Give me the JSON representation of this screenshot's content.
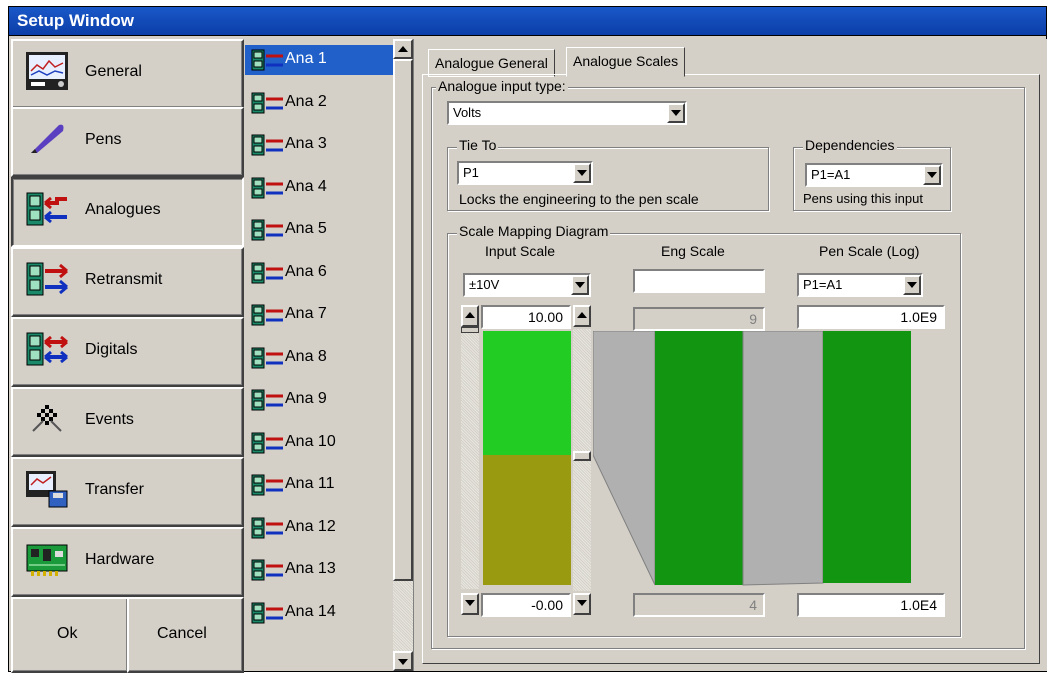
{
  "window": {
    "title": "Setup Window"
  },
  "nav": {
    "buttons": [
      {
        "label": "General",
        "icon": "recorder-icon"
      },
      {
        "label": "Pens",
        "icon": "quill-pen-icon"
      },
      {
        "label": "Analogues",
        "icon": "analogue-arrows-icon"
      },
      {
        "label": "Retransmit",
        "icon": "retransmit-arrows-icon"
      },
      {
        "label": "Digitals",
        "icon": "digital-arrows-icon"
      },
      {
        "label": "Events",
        "icon": "events-flags-icon"
      },
      {
        "label": "Transfer",
        "icon": "transfer-icon"
      },
      {
        "label": "Hardware",
        "icon": "circuit-board-icon"
      }
    ],
    "ok_label": "Ok",
    "cancel_label": "Cancel"
  },
  "channels": {
    "items": [
      "Ana 1",
      "Ana 2",
      "Ana 3",
      "Ana 4",
      "Ana 5",
      "Ana 6",
      "Ana 7",
      "Ana 8",
      "Ana 9",
      "Ana 10",
      "Ana 11",
      "Ana 12",
      "Ana 13",
      "Ana 14"
    ],
    "selected": "Ana 1"
  },
  "tabs": [
    "Analogue General",
    "Analogue Scales"
  ],
  "active_tab": "Analogue Scales",
  "scales": {
    "input_type_label": "Analogue input type:",
    "input_type_value": "Volts",
    "tie_to_label": "Tie To",
    "tie_to_value": "P1",
    "tie_to_note": "Locks the engineering to the pen scale",
    "dependencies_label": "Dependencies",
    "dependencies_value": "P1=A1",
    "dependencies_note": "Pens using this input",
    "diagram_label": "Scale Mapping Diagram",
    "input_scale_label": "Input Scale",
    "eng_scale_label": "Eng Scale",
    "pen_scale_label": "Pen Scale (Log)",
    "input_range_value": "±10V",
    "pen_scale_value": "P1=A1",
    "input_max": "10.00",
    "input_min": "-0.00",
    "eng_max": "9",
    "eng_min": "4",
    "pen_max": "1.0E9",
    "pen_min": "1.0E4"
  },
  "colors": {
    "selection": "#2060c8",
    "green_bright": "#22cc22",
    "green": "#129612",
    "olive": "#9a9a10",
    "grey": "#b0b0b0"
  }
}
